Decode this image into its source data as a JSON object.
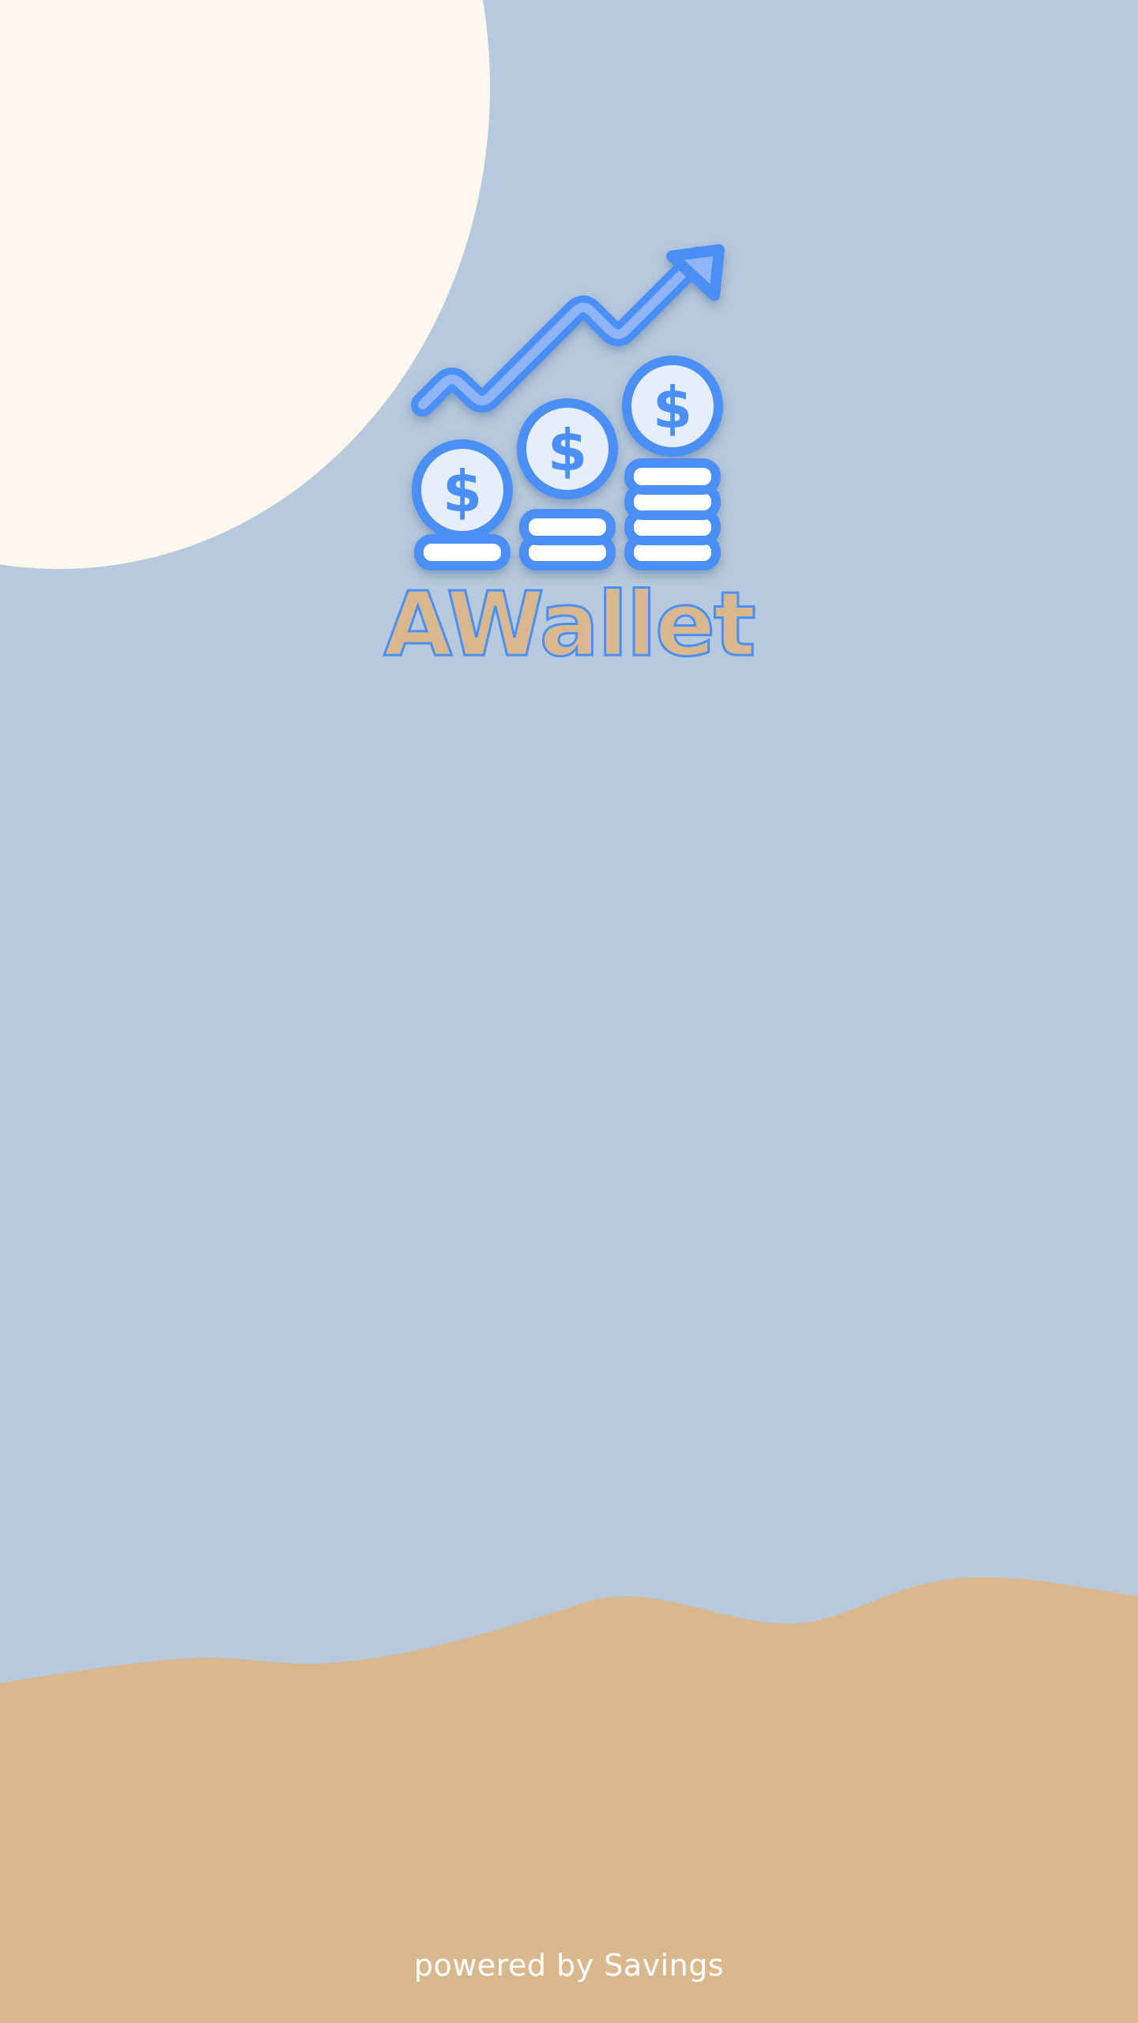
{
  "app": {
    "title": "AWallet",
    "logo_icon": "growth-chart-coins-icon"
  },
  "footer": {
    "text": "powered by Savings"
  },
  "colors": {
    "sky": "#b7c9dc",
    "sun": "#fef7ee",
    "ground": "#dab88d",
    "accent_blue": "#4a8ff5",
    "coin_fill": "#e6edfb"
  }
}
